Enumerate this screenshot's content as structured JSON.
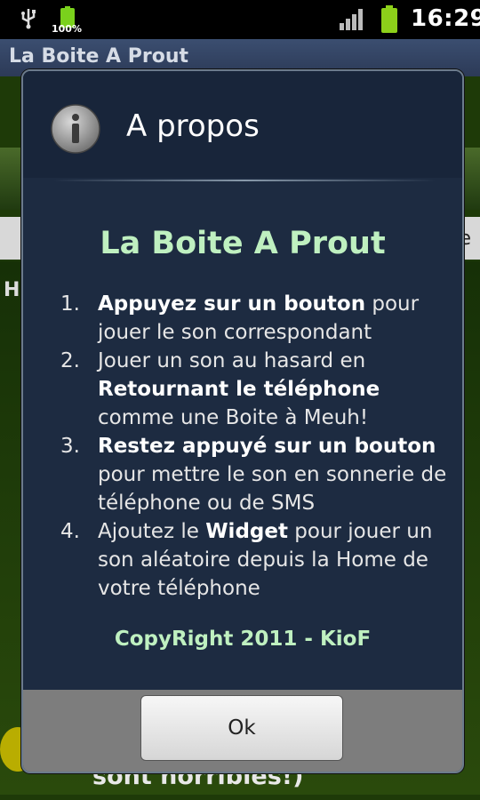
{
  "status_bar": {
    "battery_left_label": "100%",
    "clock": "16:29",
    "icons": [
      "usb-icon",
      "battery-charging-icon",
      "signal-icon",
      "battery-icon"
    ]
  },
  "app": {
    "title": "La Boite A Prout"
  },
  "background": {
    "partial_letter_left": "H",
    "partial_text_right": "re",
    "partial_bottom_text": "sont horribles!)"
  },
  "dialog": {
    "title": "A propos",
    "app_name": "La Boite A Prout",
    "items": [
      {
        "num": "1.",
        "parts": [
          {
            "b": true,
            "t": "Appuyez sur un bouton"
          },
          {
            "b": false,
            "t": " pour jouer le son correspondant"
          }
        ]
      },
      {
        "num": "2.",
        "parts": [
          {
            "b": false,
            "t": "Jouer un son au hasard en "
          },
          {
            "b": true,
            "t": "Retournant le téléphone"
          },
          {
            "b": false,
            "t": " comme une Boite à Meuh!"
          }
        ]
      },
      {
        "num": "3.",
        "parts": [
          {
            "b": true,
            "t": "Restez appuyé sur un bouton"
          },
          {
            "b": false,
            "t": " pour mettre le son en sonnerie de téléphone ou de SMS"
          }
        ]
      },
      {
        "num": "4.",
        "parts": [
          {
            "b": false,
            "t": "Ajoutez le "
          },
          {
            "b": true,
            "t": "Widget"
          },
          {
            "b": false,
            "t": " pour jouer un son aléatoire depuis la Home de votre téléphone"
          }
        ]
      }
    ],
    "copyright": "CopyRight 2011 - KioF",
    "ok_label": "Ok"
  },
  "colors": {
    "accent_green": "#bff0c0",
    "dialog_bg": "#1d2b41",
    "titlebar": "#2c3a57"
  }
}
